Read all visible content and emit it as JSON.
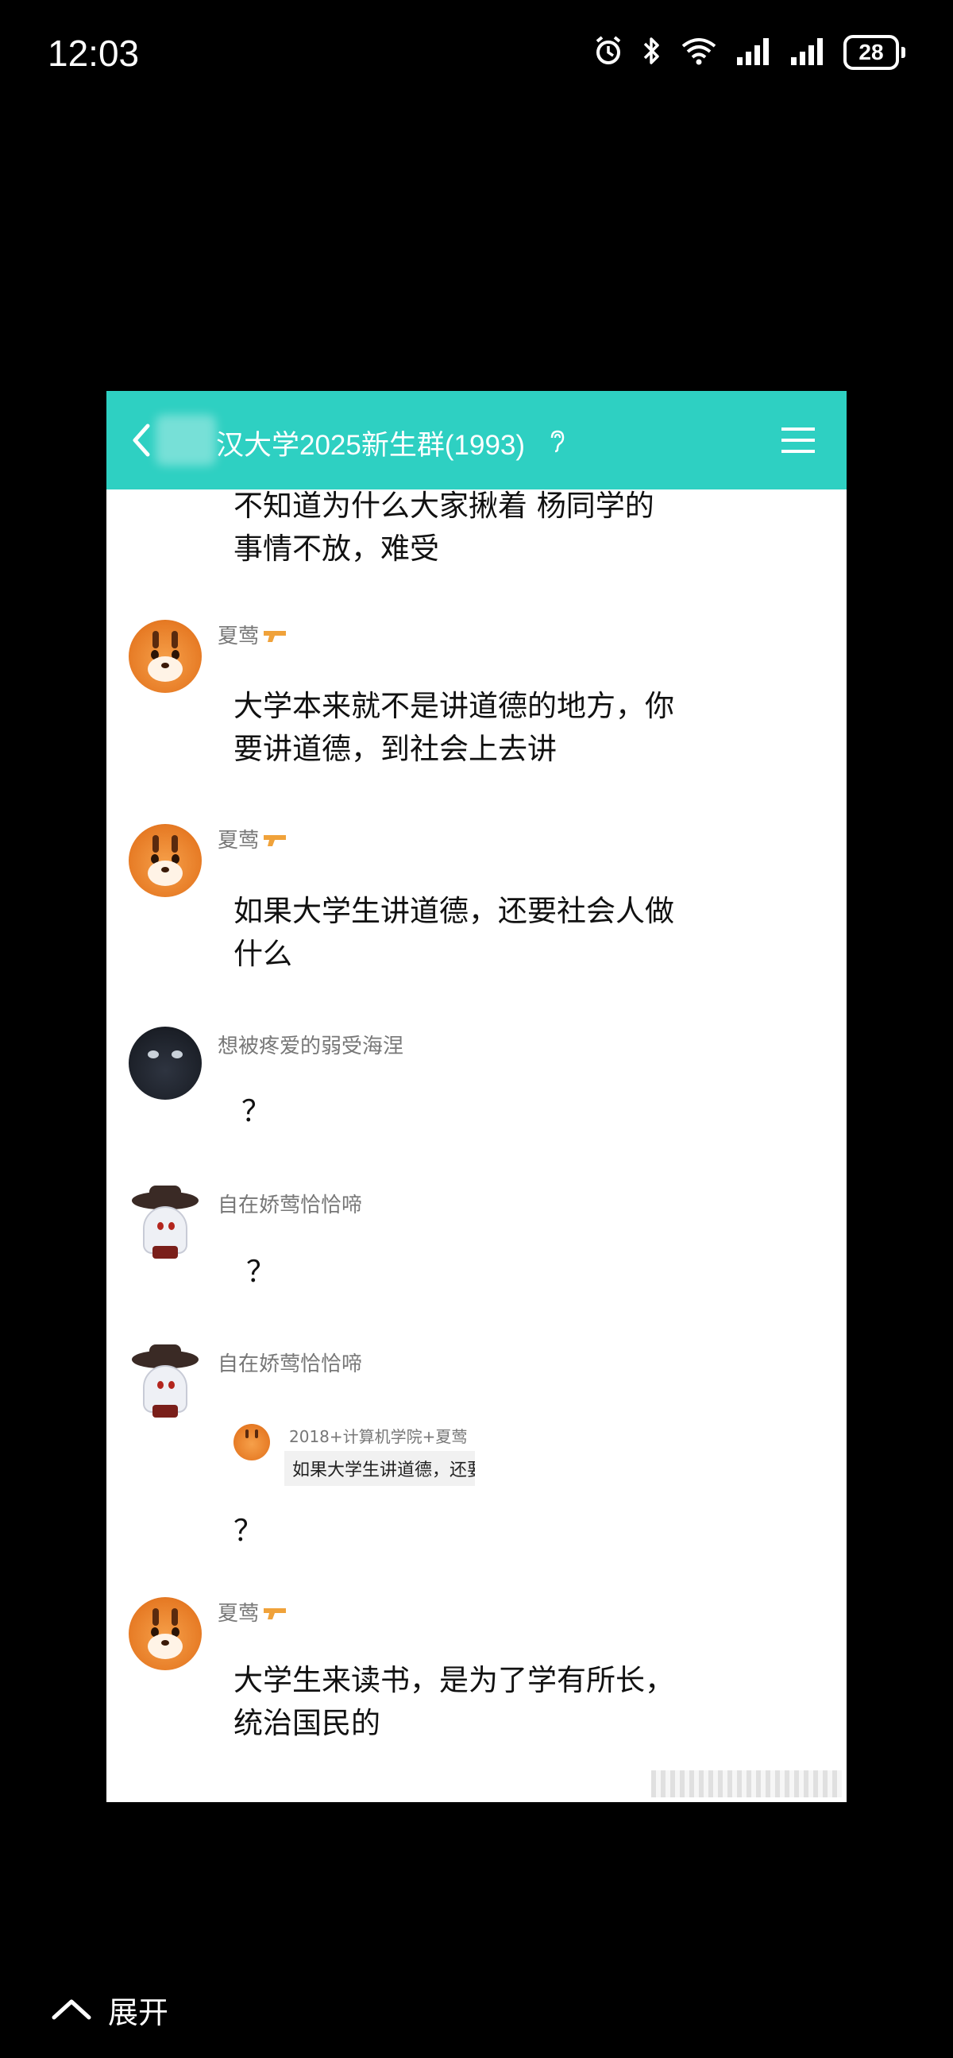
{
  "status_bar": {
    "time": "12:03",
    "battery": "28",
    "icons": [
      "alarm-icon",
      "bluetooth-icon",
      "wifi-icon",
      "signal-icon",
      "signal-icon",
      "battery-icon"
    ]
  },
  "chat": {
    "title": "汉大学2025新生群(1993)",
    "header_color": "#2ed0c2",
    "messages": [
      {
        "sender": "",
        "text_lines": [
          "不知道为什么大家揪着 杨同学的",
          "事情不放，难受"
        ]
      },
      {
        "sender": "夏莺",
        "text_lines": [
          "大学本来就不是讲道德的地方，你",
          "要讲道德，到社会上去讲"
        ]
      },
      {
        "sender": "夏莺",
        "text_lines": [
          "如果大学生讲道德，还要社会人做",
          "什么"
        ]
      },
      {
        "sender": "想被疼爱的弱受海涅",
        "text_lines": [
          "？"
        ]
      },
      {
        "sender": "自在娇莺恰恰啼",
        "text_lines": [
          "？"
        ]
      },
      {
        "sender": "自在娇莺恰恰啼",
        "quote": {
          "sender": "2018+计算机学院+夏莺",
          "text": "如果大学生讲道德，还要"
        },
        "text_lines": [
          "？"
        ]
      },
      {
        "sender": "夏莺",
        "text_lines": [
          "大学生来读书，是为了学有所长，",
          "统治国民的"
        ]
      }
    ]
  },
  "footer": {
    "expand_label": "展开"
  }
}
